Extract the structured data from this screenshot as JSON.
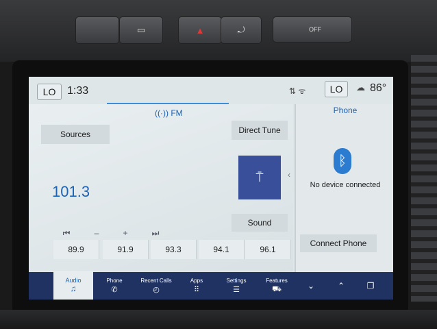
{
  "hardware": {
    "btn_fog_icon": "fog-light-icon",
    "btn_hazard_icon": "hazard-icon",
    "btn_camera_icon": "camera-icon",
    "btn_tc_label": "OFF"
  },
  "status": {
    "lo_left": "LO",
    "time": "1:33",
    "lo_right": "LO",
    "temperature": "86°"
  },
  "audio": {
    "band": "FM",
    "sources_label": "Sources",
    "direct_tune_label": "Direct Tune",
    "frequency": "101.3",
    "sound_label": "Sound",
    "controls": [
      "⏮",
      "–",
      "+",
      "⏭"
    ],
    "presets": [
      "89.9",
      "91.9",
      "93.3",
      "94.1",
      "96.1"
    ]
  },
  "phone": {
    "title": "Phone",
    "status": "No device connected",
    "connect_label": "Connect Phone"
  },
  "nav": {
    "audio": "Audio",
    "phone": "Phone",
    "recent_calls": "Recent Calls",
    "apps": "Apps",
    "settings": "Settings",
    "features": "Features"
  },
  "colors": {
    "accent": "#1d63b5",
    "navbar": "#1f3261",
    "radio_icon_bg": "#3a4f9a"
  }
}
